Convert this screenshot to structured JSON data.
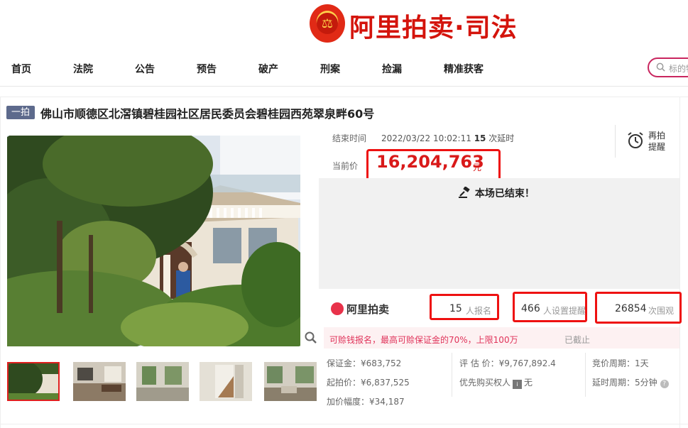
{
  "header": {
    "logo_text": "阿里拍卖·司法",
    "logo_symbol": "⚖"
  },
  "nav": {
    "items": [
      "首页",
      "法院",
      "公告",
      "预告",
      "破产",
      "刑案",
      "捡漏",
      "精准获客"
    ],
    "search_placeholder": "标的物"
  },
  "item": {
    "badge": "一拍",
    "title": "佛山市顺德区北滘镇碧桂园社区居民委员会碧桂园西苑翠泉畔60号"
  },
  "auction": {
    "end_time_label": "结束时间",
    "end_time": "2022/03/22 10:02:11",
    "delay_count": "15",
    "delay_suffix": "次延时",
    "remind_label": "再拍提醒",
    "current_price_label": "当前价",
    "current_price": "16,204,763",
    "price_unit": "元",
    "ended_text": "本场已结束！",
    "platform_name": "阿里拍卖",
    "signups": "15",
    "signups_label": "人报名",
    "reminders": "466",
    "reminders_label": "人设置提醒",
    "views": "26854",
    "views_label": "次围观",
    "notice": "可赊钱报名，最高可赊保证金的70%，上限100万",
    "notice_status": "已截止"
  },
  "details": {
    "deposit": "保证金：¥683,752",
    "start_price": "起拍价：¥6,837,525",
    "increment": "加价幅度：¥34,187",
    "appraisal": "评 估 价：¥9,767,892.4",
    "priority_label": "优先购买权人",
    "priority_value": "无",
    "cycle": "竞价周期：1天",
    "delay_period": "延时周期：5分钟"
  },
  "colors": {
    "accent_red": "#d91a1a",
    "highlight_box": "#ee1111",
    "brand_red": "#d4140c",
    "badge_bg": "#5d6a8c",
    "notice_pink": "#e0335a"
  }
}
